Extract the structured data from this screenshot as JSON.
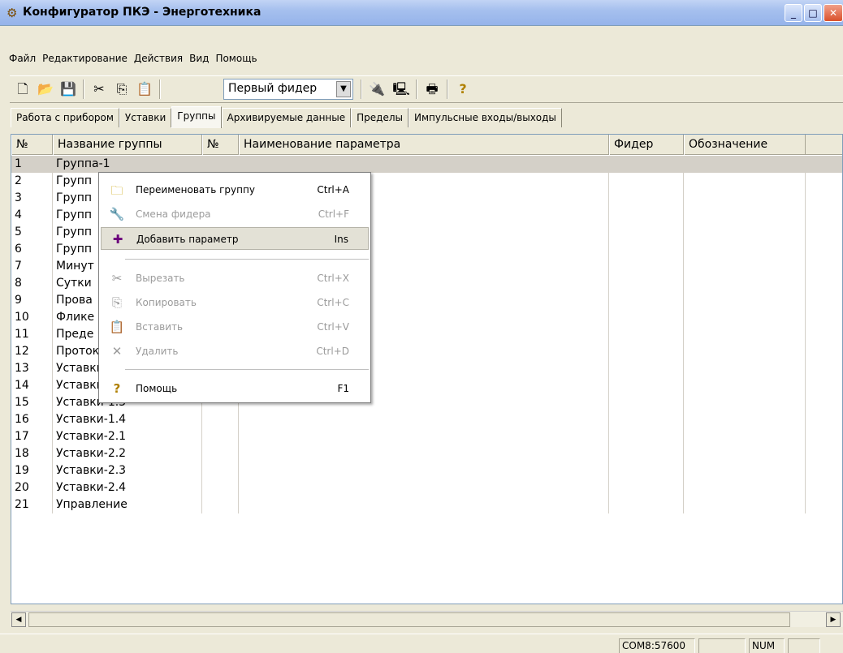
{
  "window": {
    "title": "Конфигуратор ПКЭ - Энерготехника"
  },
  "menu": [
    "Файл",
    "Редактирование",
    "Действия",
    "Вид",
    "Помощь"
  ],
  "toolbar": {
    "feeder_selected": "Первый фидер"
  },
  "tabs": [
    "Работа с прибором",
    "Уставки",
    "Группы",
    "Архивируемые данные",
    "Пределы",
    "Импульсные входы/выходы"
  ],
  "active_tab": "Группы",
  "grid": {
    "headers": [
      "№",
      "Название группы",
      "№",
      "Наименование параметра",
      "Фидер",
      "Обозначение"
    ],
    "rows": [
      {
        "n": "1",
        "name": "Группа-1"
      },
      {
        "n": "2",
        "name": "Групп"
      },
      {
        "n": "3",
        "name": "Групп"
      },
      {
        "n": "4",
        "name": "Групп"
      },
      {
        "n": "5",
        "name": "Групп"
      },
      {
        "n": "6",
        "name": "Групп"
      },
      {
        "n": "7",
        "name": "Минут"
      },
      {
        "n": "8",
        "name": "Сутки"
      },
      {
        "n": "9",
        "name": "Прова"
      },
      {
        "n": "10",
        "name": "Фликe"
      },
      {
        "n": "11",
        "name": "Преде"
      },
      {
        "n": "12",
        "name": "Протокол"
      },
      {
        "n": "13",
        "name": "Уставки-1.1"
      },
      {
        "n": "14",
        "name": "Уставки-1.2"
      },
      {
        "n": "15",
        "name": "Уставки-1.3"
      },
      {
        "n": "16",
        "name": "Уставки-1.4"
      },
      {
        "n": "17",
        "name": "Уставки-2.1"
      },
      {
        "n": "18",
        "name": "Уставки-2.2"
      },
      {
        "n": "19",
        "name": "Уставки-2.3"
      },
      {
        "n": "20",
        "name": "Уставки-2.4"
      },
      {
        "n": "21",
        "name": "Управление"
      }
    ]
  },
  "context_menu": {
    "items": [
      {
        "label": "Переименовать группу",
        "shortcut": "Ctrl+A",
        "icon": "folder-icon",
        "glyph": "🗀",
        "enabled": true
      },
      {
        "label": "Смена фидера",
        "shortcut": "Ctrl+F",
        "icon": "wrench-icon",
        "glyph": "🔧",
        "enabled": false
      },
      {
        "label": "Добавить параметр",
        "shortcut": "Ins",
        "icon": "plus-icon",
        "glyph": "✚",
        "enabled": true
      },
      {
        "label": "Вырезать",
        "shortcut": "Ctrl+X",
        "icon": "scissors-icon",
        "glyph": "✂",
        "enabled": false
      },
      {
        "label": "Копировать",
        "shortcut": "Ctrl+C",
        "icon": "copy-icon",
        "glyph": "⎘",
        "enabled": false
      },
      {
        "label": "Вставить",
        "shortcut": "Ctrl+V",
        "icon": "paste-icon",
        "glyph": "📋",
        "enabled": false
      },
      {
        "label": "Удалить",
        "shortcut": "Ctrl+D",
        "icon": "delete-icon",
        "glyph": "✕",
        "enabled": false
      },
      {
        "label": "Помощь",
        "shortcut": "F1",
        "icon": "help-icon",
        "glyph": "?",
        "enabled": true
      }
    ]
  },
  "status": {
    "port": "COM8:57600",
    "num": "NUM"
  }
}
